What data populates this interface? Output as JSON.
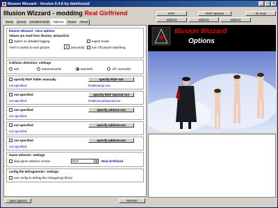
{
  "window": {
    "title": "Illusion Wizzard - Version 0.4.6 by darkhound"
  },
  "header": {
    "prefix": "Illusion Wizzard - modding",
    "accent": "Real Girlfriend"
  },
  "top_buttons": {
    "rgf": "RGF",
    "rgf_special": "RGF Special",
    "d4": "d4 mod",
    "addon2": "addon2",
    "addon3": "addon3",
    "addon4": "addon4"
  },
  "tabs": [
    "Mods",
    "Queue",
    "installed Mods",
    "Options",
    "Status",
    "About"
  ],
  "options": {
    "misc_title": "Illusion Wizzard - misc options",
    "values_read": "Values are read from illusion_wizzard.ini",
    "switch_logging": "switch on detailed logging",
    "expert_mode": "expert mode",
    "time_label": "Time to switch to next picture",
    "time_value": "3",
    "seconds": "[seconds]",
    "turn_off_switching": "turn off picture switching",
    "collision_title": "Collision detection: settings",
    "radio": [
      "ask",
      "auto/overwrite",
      "auto/ask",
      "off / overwrite"
    ],
    "rows": [
      {
        "check": "specify RGF folder manually",
        "button": "specify RGF exe",
        "left": "not specified",
        "right": "RealKanojo.exe"
      },
      {
        "check": "not specified",
        "button": "specify RGF Special exe",
        "left": "not specified",
        "right": "RealKanojoSpecial.exe"
      },
      {
        "check": "not specified",
        "button": "specify addon2 exe",
        "left": "not specified",
        "right": ""
      },
      {
        "check": "not specified",
        "button": "specify addon3 exe",
        "left": "not specified",
        "right": ""
      },
      {
        "check": "not specified",
        "button": "specify addon4 exe",
        "left": "not specified",
        "right": ""
      }
    ],
    "game_selector_title": "Game Selector: settings",
    "skip_selector": "skip game selector screen",
    "selector_value": "RGF",
    "selector_label": "Real Girlfriend",
    "defrag_title": "config file defragmenter: settings",
    "defrag_check": "use config to defrag the changed pp file(s)"
  },
  "preview": {
    "title_line1": "Illusion Wizzard",
    "title_line2": "Options"
  },
  "bottom": {
    "save": "save options",
    "refresh": "Refresh"
  },
  "colors": {
    "title_bar": "#0a246a",
    "accent": "#cc0000",
    "link_blue": "#0000cc"
  }
}
